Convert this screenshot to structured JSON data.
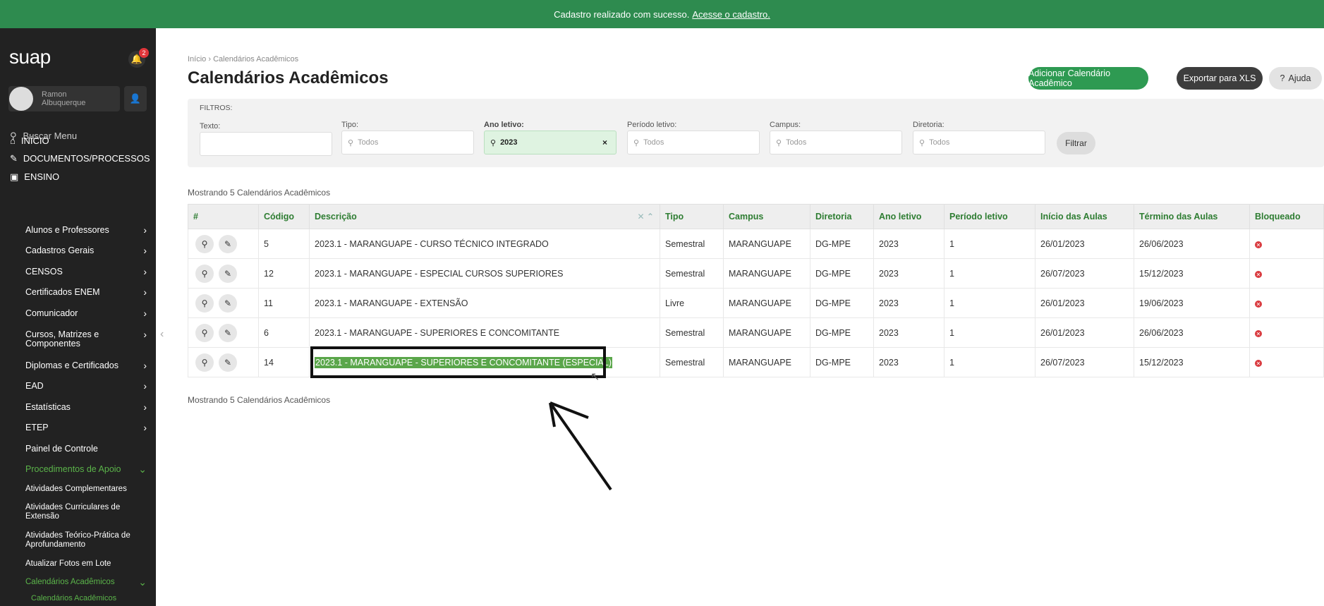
{
  "notice": {
    "text": "Cadastro realizado com sucesso.",
    "link": "Acesse o cadastro."
  },
  "sidebar": {
    "logo": "suap",
    "notifications": "2",
    "user_name_line1": "Ramon",
    "user_name_line2": "Albuquerque",
    "search": "Buscar Menu",
    "top_items": [
      "INÍCIO",
      "DOCUMENTOS/PROCESSOS",
      "ENSINO"
    ],
    "items": [
      "Alunos e Professores",
      "Cadastros Gerais",
      "CENSOS",
      "Certificados ENEM",
      "Comunicador",
      "Cursos, Matrizes e Componentes",
      "Diplomas e Certificados",
      "EAD",
      "Estatísticas",
      "ETEP",
      "Painel de Controle",
      "Procedimentos de Apoio",
      "Atividades Complementares",
      "Atividades Curriculares de Extensão",
      "Atividades Teórico-Prática de Aprofundamento",
      "Atualizar Fotos em Lote",
      "Calendários Acadêmicos",
      "Calendários Acadêmicos"
    ]
  },
  "breadcrumb": {
    "home": "Início",
    "sep": "›",
    "current": "Calendários Acadêmicos"
  },
  "title": "Calendários Acadêmicos",
  "actions": {
    "add": "Adicionar Calendário Acadêmico",
    "export": "Exportar para XLS",
    "help": "Ajuda"
  },
  "filters": {
    "title": "FILTROS:",
    "texto_label": "Texto:",
    "tipo_label": "Tipo:",
    "tipo_value": "Todos",
    "ano_label": "Ano letivo:",
    "ano_value": "2023",
    "periodo_label": "Período letivo:",
    "periodo_value": "Todos",
    "campus_label": "Campus:",
    "campus_value": "Todos",
    "diretoria_label": "Diretoria:",
    "diretoria_value": "Todos",
    "submit": "Filtrar"
  },
  "showing": "Mostrando 5 Calendários Acadêmicos",
  "table": {
    "headers": [
      "#",
      "Código",
      "Descrição",
      "Tipo",
      "Campus",
      "Diretoria",
      "Ano letivo",
      "Período letivo",
      "Início das Aulas",
      "Término das Aulas",
      "Bloqueado"
    ],
    "rows": [
      {
        "codigo": "5",
        "descricao": "2023.1 - MARANGUAPE - CURSO TÉCNICO INTEGRADO",
        "tipo": "Semestral",
        "campus": "MARANGUAPE",
        "diretoria": "DG-MPE",
        "ano": "2023",
        "periodo": "1",
        "inicio": "26/01/2023",
        "termino": "26/06/2023"
      },
      {
        "codigo": "12",
        "descricao": "2023.1 - MARANGUAPE - ESPECIAL CURSOS SUPERIORES",
        "tipo": "Semestral",
        "campus": "MARANGUAPE",
        "diretoria": "DG-MPE",
        "ano": "2023",
        "periodo": "1",
        "inicio": "26/07/2023",
        "termino": "15/12/2023"
      },
      {
        "codigo": "11",
        "descricao": "2023.1 - MARANGUAPE - EXTENSÃO",
        "tipo": "Livre",
        "campus": "MARANGUAPE",
        "diretoria": "DG-MPE",
        "ano": "2023",
        "periodo": "1",
        "inicio": "26/01/2023",
        "termino": "19/06/2023"
      },
      {
        "codigo": "6",
        "descricao": "2023.1 - MARANGUAPE - SUPERIORES E CONCOMITANTE",
        "tipo": "Semestral",
        "campus": "MARANGUAPE",
        "diretoria": "DG-MPE",
        "ano": "2023",
        "periodo": "1",
        "inicio": "26/01/2023",
        "termino": "26/06/2023"
      },
      {
        "codigo": "14",
        "descricao": "2023.1 - MARANGUAPE - SUPERIORES E CONCOMITANTE (ESPECIAL)",
        "tipo": "Semestral",
        "campus": "MARANGUAPE",
        "diretoria": "DG-MPE",
        "ano": "2023",
        "periodo": "1",
        "inicio": "26/07/2023",
        "termino": "15/12/2023"
      }
    ]
  },
  "colors": {
    "green": "#2e8b4f",
    "sidebar": "#222222",
    "highlight": "#5aa64a",
    "blocked": "#d9393e"
  }
}
